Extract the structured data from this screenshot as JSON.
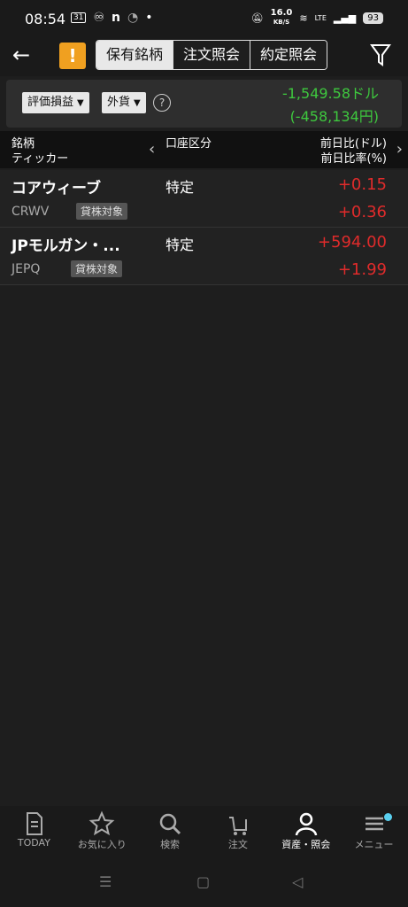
{
  "status": {
    "time": "08:54",
    "speed_top": "16.0",
    "speed_bottom": "KB/S",
    "lte": "LTE",
    "battery": "93"
  },
  "header": {
    "tabs": [
      {
        "label": "保有銘柄"
      },
      {
        "label": "注文照会"
      },
      {
        "label": "約定照会"
      }
    ],
    "warning": "!"
  },
  "summary": {
    "dropdown1": "評価損益",
    "dropdown2": "外貨",
    "help": "?",
    "pl_dollar": "-1,549.58ドル",
    "pl_yen": "(-458,134円)"
  },
  "columns": {
    "name1": "銘柄",
    "name2": "ティッカー",
    "account": "口座区分",
    "right1": "前日比(ドル)",
    "right2": "前日比率(%)"
  },
  "holdings": [
    {
      "name": "コアウィーブ",
      "ticker": "CRWV",
      "badge": "貸株対象",
      "account": "特定",
      "change": "+0.15",
      "change_pct": "+0.36"
    },
    {
      "name": "JPモルガン・...",
      "ticker": "JEPQ",
      "badge": "貸株対象",
      "account": "特定",
      "change": "+594.00",
      "change_pct": "+1.99"
    }
  ],
  "nav": [
    {
      "label": "TODAY",
      "icon": "document-icon"
    },
    {
      "label": "お気に入り",
      "icon": "star-icon"
    },
    {
      "label": "検索",
      "icon": "search-icon"
    },
    {
      "label": "注文",
      "icon": "cart-icon"
    },
    {
      "label": "資産・照会",
      "icon": "person-icon"
    },
    {
      "label": "メニュー",
      "icon": "menu-icon"
    }
  ],
  "colors": {
    "positive": "#e02b2b",
    "pl": "#3ec83e",
    "warning": "#f0a020"
  }
}
